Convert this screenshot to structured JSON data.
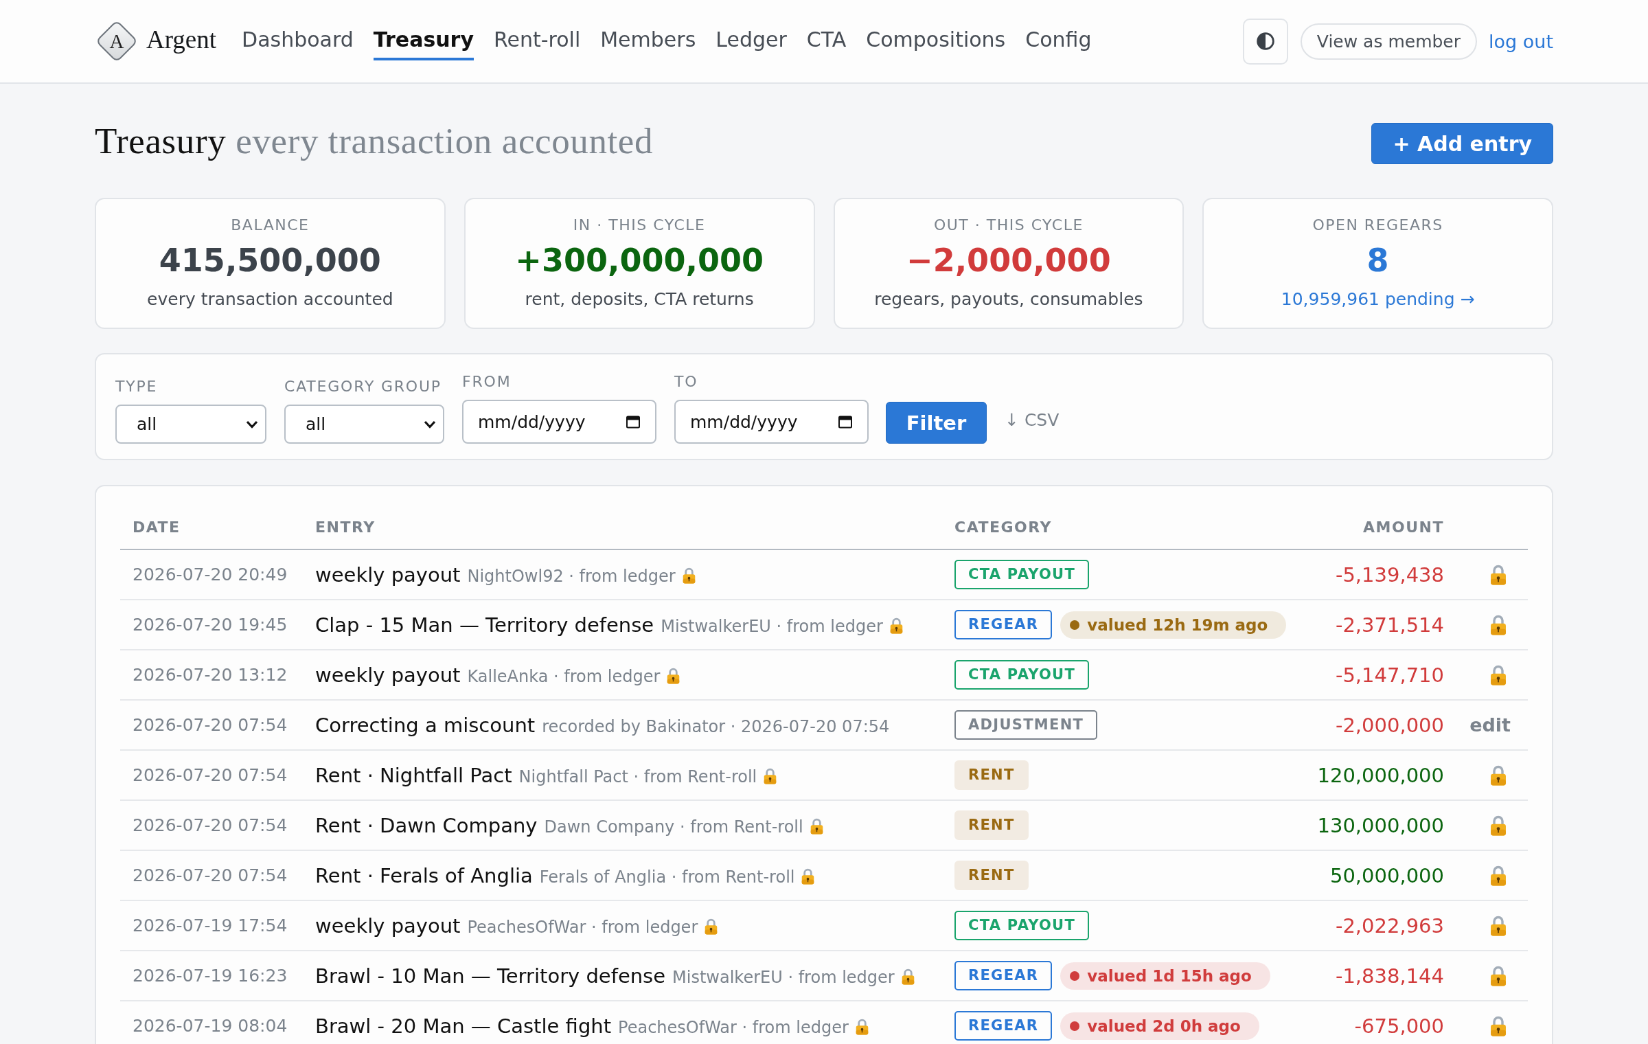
{
  "top_bar": {
    "logo": {
      "letter": "A",
      "name": "Argent"
    },
    "nav": [
      {
        "label": "Dashboard",
        "selected": false
      },
      {
        "label": "Treasury",
        "selected": true
      },
      {
        "label": "Rent-roll",
        "selected": false
      },
      {
        "label": "Members",
        "selected": false
      },
      {
        "label": "Ledger",
        "selected": false
      },
      {
        "label": "CTA",
        "selected": false
      },
      {
        "label": "Compositions",
        "selected": false
      },
      {
        "label": "Config",
        "selected": false
      }
    ],
    "view_as_member": "View as member",
    "logout": "log out"
  },
  "page_header": {
    "title": "Treasury",
    "subtitle": "every transaction accounted",
    "add_button": "+ Add entry"
  },
  "stats": [
    {
      "label": "BALANCE",
      "value": "415,500,000",
      "kind": "neutral",
      "note": "every transaction accounted"
    },
    {
      "label": "IN · THIS CYCLE",
      "value": "+300,000,000",
      "kind": "positive",
      "note": "rent, deposits, CTA returns"
    },
    {
      "label": "OUT · THIS CYCLE",
      "value": "−2,000,000",
      "kind": "negative",
      "note": "regears, payouts, consumables"
    },
    {
      "label": "OPEN REGEARS",
      "value": "8",
      "kind": "accent",
      "link": "10,959,961 pending →"
    }
  ],
  "filters": {
    "type": {
      "label": "TYPE",
      "value": "all"
    },
    "category_group": {
      "label": "CATEGORY GROUP",
      "value": "all"
    },
    "from": {
      "label": "FROM",
      "placeholder": "mm/dd/yyyy"
    },
    "to": {
      "label": "TO",
      "placeholder": "mm/dd/yyyy"
    },
    "filter_button": "Filter",
    "csv_link": "↓ CSV"
  },
  "table": {
    "columns": [
      "DATE",
      "ENTRY",
      "CATEGORY",
      "AMOUNT"
    ],
    "rows": [
      {
        "date": "2026-07-20 20:49",
        "title": "weekly payout",
        "meta": "NightOwl92 · from ledger",
        "locked": true,
        "category": {
          "label": "CTA PAYOUT",
          "kind": "cta_payout"
        },
        "amount": "-5,139,438",
        "negative": true
      },
      {
        "date": "2026-07-20 19:45",
        "title": "Clap - 15 Man — Territory defense",
        "meta": "MistwalkerEU · from ledger",
        "locked": true,
        "category": {
          "label": "REGEAR",
          "kind": "regear"
        },
        "valuation": {
          "text": "valued 12h 19m ago",
          "color": "#9a6a12"
        },
        "amount": "-2,371,514",
        "negative": true
      },
      {
        "date": "2026-07-20 13:12",
        "title": "weekly payout",
        "meta": "KalleAnka · from ledger",
        "locked": true,
        "category": {
          "label": "CTA PAYOUT",
          "kind": "cta_payout"
        },
        "amount": "-5,147,710",
        "negative": true
      },
      {
        "date": "2026-07-20 07:54",
        "title": "Correcting a miscount",
        "meta": "recorded by Bakinator · 2026-07-20 07:54",
        "locked": false,
        "edit_label": "edit",
        "category": {
          "label": "ADJUSTMENT",
          "kind": "adjustment"
        },
        "amount": "-2,000,000",
        "negative": true
      },
      {
        "date": "2026-07-20 07:54",
        "title": "Rent · Nightfall Pact",
        "meta": "Nightfall Pact · from Rent-roll",
        "locked": true,
        "category": {
          "label": "RENT",
          "kind": "rent"
        },
        "amount": "120,000,000",
        "negative": false
      },
      {
        "date": "2026-07-20 07:54",
        "title": "Rent · Dawn Company",
        "meta": "Dawn Company · from Rent-roll",
        "locked": true,
        "category": {
          "label": "RENT",
          "kind": "rent"
        },
        "amount": "130,000,000",
        "negative": false
      },
      {
        "date": "2026-07-20 07:54",
        "title": "Rent · Ferals of Anglia",
        "meta": "Ferals of Anglia · from Rent-roll",
        "locked": true,
        "category": {
          "label": "RENT",
          "kind": "rent"
        },
        "amount": "50,000,000",
        "negative": false
      },
      {
        "date": "2026-07-19 17:54",
        "title": "weekly payout",
        "meta": "PeachesOfWar · from ledger",
        "locked": true,
        "category": {
          "label": "CTA PAYOUT",
          "kind": "cta_payout"
        },
        "amount": "-2,022,963",
        "negative": true
      },
      {
        "date": "2026-07-19 16:23",
        "title": "Brawl - 10 Man — Territory defense",
        "meta": "MistwalkerEU · from ledger",
        "locked": true,
        "category": {
          "label": "REGEAR",
          "kind": "regear"
        },
        "valuation": {
          "text": "valued 1d 15h ago",
          "color": "#d03c3c"
        },
        "amount": "-1,838,144",
        "negative": true
      },
      {
        "date": "2026-07-19 08:04",
        "title": "Brawl - 20 Man — Castle fight",
        "meta": "PeachesOfWar · from ledger",
        "locked": true,
        "category": {
          "label": "REGEAR",
          "kind": "regear"
        },
        "valuation": {
          "text": "valued 2d 0h ago",
          "color": "#d03c3c"
        },
        "amount": "-675,000",
        "negative": true
      }
    ]
  }
}
